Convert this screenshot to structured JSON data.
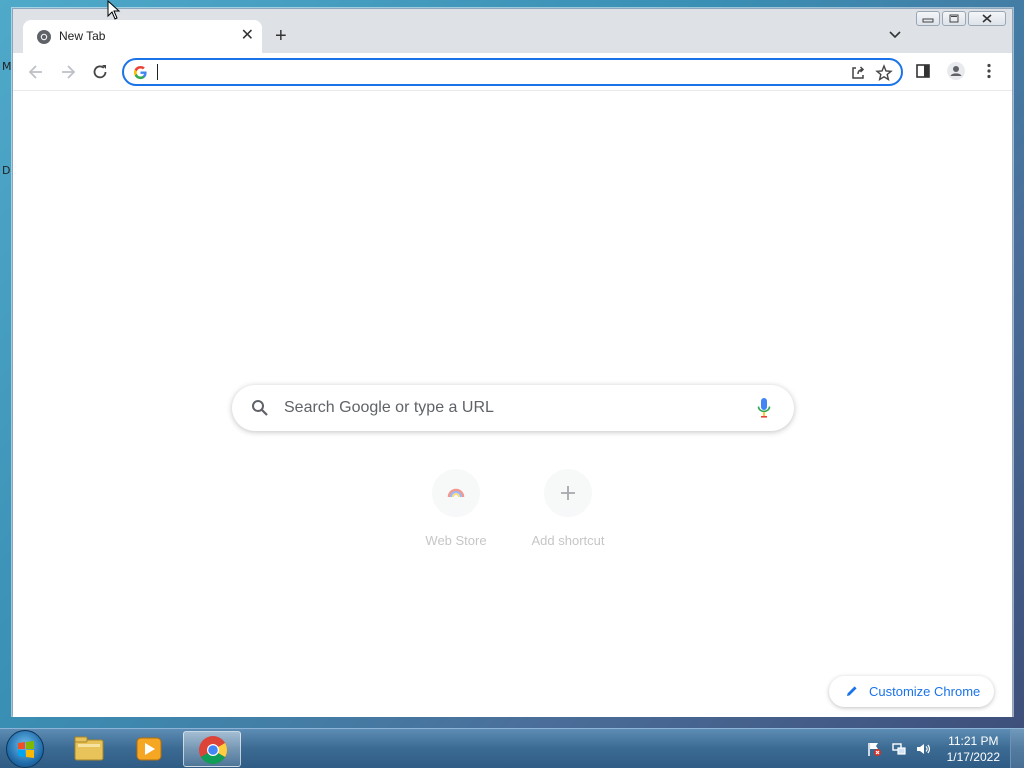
{
  "desktop": {
    "edge_labels": [
      "M",
      "D"
    ]
  },
  "browser": {
    "tab": {
      "title": "New Tab"
    },
    "omnibox": {
      "value": ""
    },
    "ntp": {
      "search_placeholder": "Search Google or type a URL",
      "shortcuts": [
        {
          "label": "Web Store",
          "icon": "web-store-icon"
        },
        {
          "label": "Add shortcut",
          "icon": "plus-icon"
        }
      ],
      "customize_label": "Customize Chrome"
    }
  },
  "taskbar": {
    "apps": [
      "windows-explorer-icon",
      "media-player-icon",
      "chrome-icon"
    ],
    "active_app": "chrome-icon",
    "clock_time": "11:21 PM",
    "clock_date": "1/17/2022"
  },
  "colors": {
    "accent": "#1a73e8",
    "tab_strip": "#dee1e6",
    "page_bg": "#ffffff"
  }
}
